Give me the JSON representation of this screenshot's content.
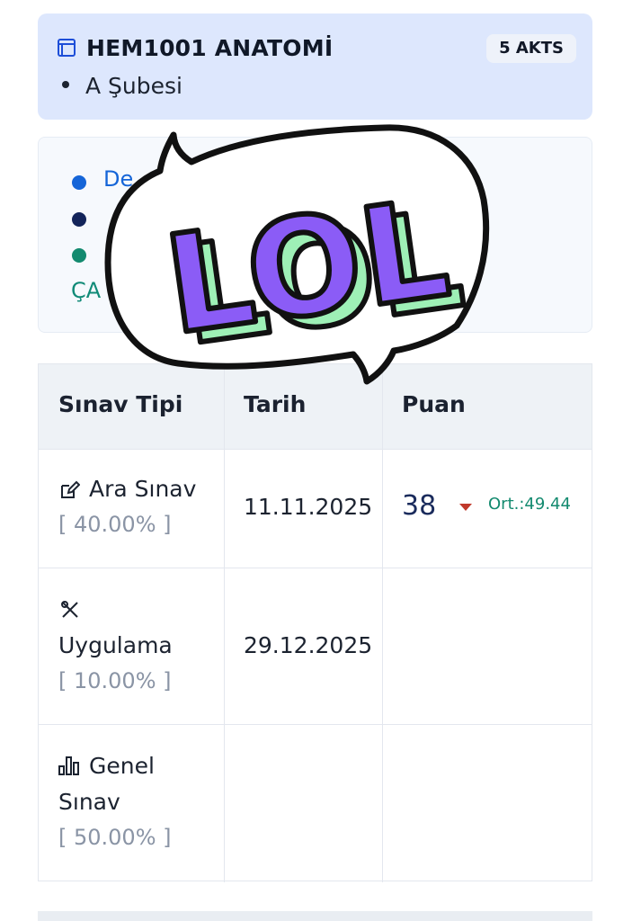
{
  "course": {
    "code_name": "HEM1001 ANATOMİ",
    "akts": "5 AKTS",
    "section": "A Şubesi"
  },
  "legend": {
    "items": [
      {
        "label": "De",
        "color": "#1565d8"
      },
      {
        "label": "",
        "color": "#13245a"
      },
      {
        "label": "",
        "color": "#138a6f"
      }
    ],
    "link_text": "ÇA"
  },
  "table": {
    "headers": [
      "Sınav Tipi",
      "Tarih",
      "Puan"
    ],
    "rows": [
      {
        "type": "Ara Sınav",
        "weight": "[ 40.00% ]",
        "date": "11.11.2025",
        "score": "38",
        "average": "Ort.:49.44",
        "icon": "edit-icon"
      },
      {
        "type": "Uygulama",
        "weight": "[ 10.00% ]",
        "date": "29.12.2025",
        "score": "",
        "average": "",
        "icon": "tools-icon"
      },
      {
        "type_line1": "Genel",
        "type_line2": "Sınav",
        "weight": "[ 50.00% ]",
        "date": "",
        "score": "",
        "average": "",
        "icon": "bar-chart-icon"
      }
    ]
  },
  "sticker": {
    "text": "LOL",
    "fill": "#8b5cf6",
    "shade": "#9ef0b6"
  }
}
